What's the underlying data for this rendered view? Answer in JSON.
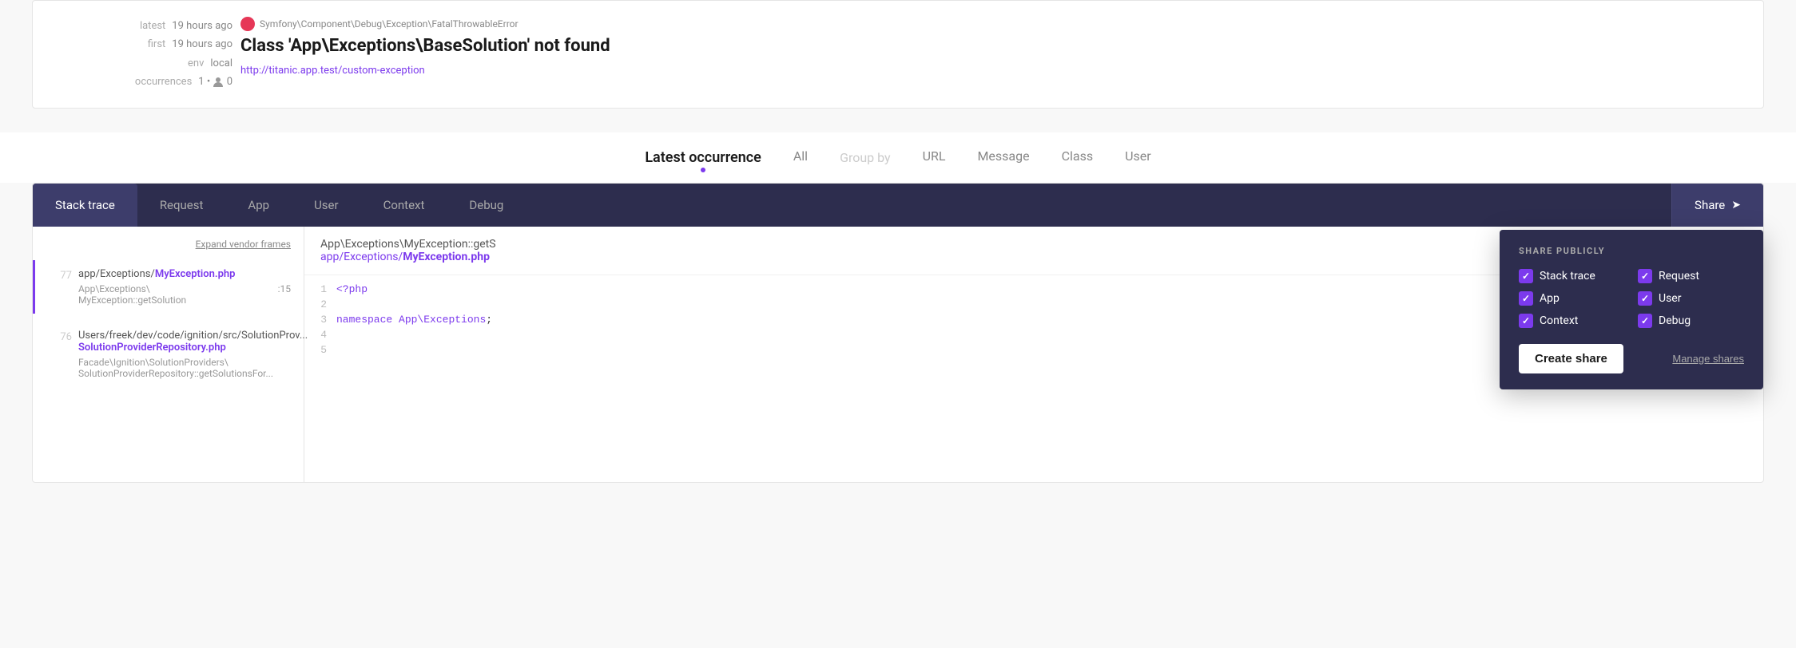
{
  "meta": {
    "latest_label": "latest",
    "latest_value": "19 hours ago",
    "first_label": "first",
    "first_value": "19 hours ago",
    "env_label": "env",
    "env_value": "local",
    "occurrences_label": "occurrences",
    "occurrences_value": "1",
    "user_count": "0"
  },
  "exception": {
    "class_path": "Symfony\\Component\\Debug\\Exception\\FatalThrowableError",
    "title": "Class 'App\\Exceptions\\BaseSolution' not found",
    "url": "http://titanic.app.test/custom-exception"
  },
  "occurrence_nav": {
    "label": "Latest occurrence",
    "items": [
      "All",
      "Group by",
      "URL",
      "Message",
      "Class",
      "User"
    ]
  },
  "tabs": {
    "items": [
      "Stack trace",
      "Request",
      "App",
      "User",
      "Context",
      "Debug"
    ],
    "active": "Stack trace",
    "share_label": "Share"
  },
  "file_sidebar": {
    "expand_label": "Expand vendor frames",
    "frames": [
      {
        "number": "77",
        "path": "app/Exceptions/",
        "file": "MyException.php",
        "call": "App\\Exceptions\\MyException::getSolution",
        "line": ":15"
      },
      {
        "number": "76",
        "path": "Users/freek/dev/code/ignition/src/",
        "file": "SolutionProviderRepository.php",
        "call": "Facade\\Ignition\\SolutionProviders\\SolutionProviderRepository::getSolutionsFor...",
        "line": ""
      }
    ]
  },
  "code_header": {
    "class_path": "App\\Exceptions\\MyException::getS",
    "file_path": "app/Exceptions/",
    "file_name": "MyException.php"
  },
  "code_lines": [
    {
      "ln": "1",
      "code": "<?php",
      "type": "kw"
    },
    {
      "ln": "2",
      "code": ""
    },
    {
      "ln": "3",
      "code": "namespace App\\Exceptions;",
      "type": "ns"
    },
    {
      "ln": "4",
      "code": ""
    },
    {
      "ln": "5",
      "code": ""
    }
  ],
  "share_dropdown": {
    "title": "SHARE PUBLICLY",
    "options": [
      {
        "id": "stack_trace",
        "label": "Stack trace",
        "checked": true
      },
      {
        "id": "request",
        "label": "Request",
        "checked": true
      },
      {
        "id": "app",
        "label": "App",
        "checked": true
      },
      {
        "id": "user",
        "label": "User",
        "checked": true
      },
      {
        "id": "context",
        "label": "Context",
        "checked": true
      },
      {
        "id": "debug",
        "label": "Debug",
        "checked": true
      }
    ],
    "create_label": "Create share",
    "manage_label": "Manage shares"
  }
}
